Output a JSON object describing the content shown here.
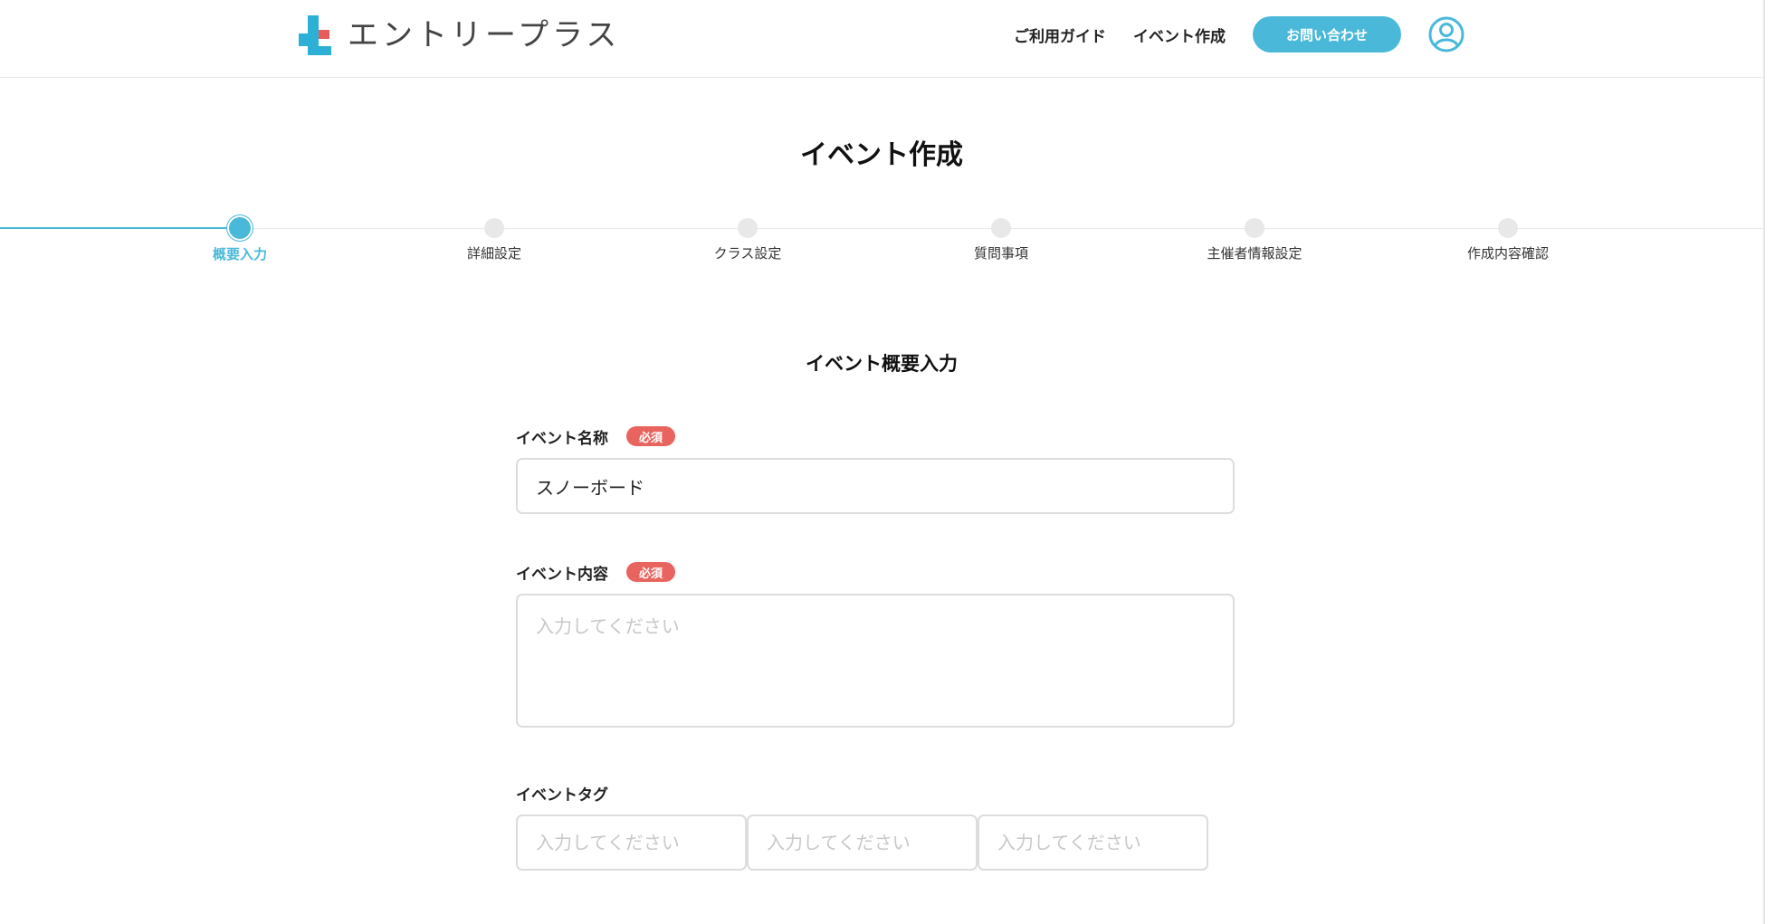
{
  "header": {
    "logo_text": "エントリープラス",
    "nav": {
      "guide": "ご利用ガイド",
      "create_event": "イベント作成",
      "contact": "お問い合わせ"
    },
    "user_icon": "user-circle-icon"
  },
  "page": {
    "title": "イベント作成"
  },
  "stepper": {
    "active_index": 0,
    "steps": [
      {
        "label": "概要入力"
      },
      {
        "label": "詳細設定"
      },
      {
        "label": "クラス設定"
      },
      {
        "label": "質問事項"
      },
      {
        "label": "主催者情報設定"
      },
      {
        "label": "作成内容確認"
      }
    ]
  },
  "form": {
    "section_title": "イベント概要入力",
    "event_name": {
      "label": "イベント名称",
      "required": "必須",
      "value": "スノーボード"
    },
    "event_content": {
      "label": "イベント内容",
      "required": "必須",
      "placeholder": "入力してください"
    },
    "event_tags": {
      "label": "イベントタグ",
      "inputs": [
        {
          "placeholder": "入力してください"
        },
        {
          "placeholder": "入力してください"
        },
        {
          "placeholder": "入力してください"
        }
      ]
    }
  },
  "colors": {
    "accent": "#4ab9d9",
    "required": "#e8655f",
    "logo_red": "#e85c5c"
  }
}
